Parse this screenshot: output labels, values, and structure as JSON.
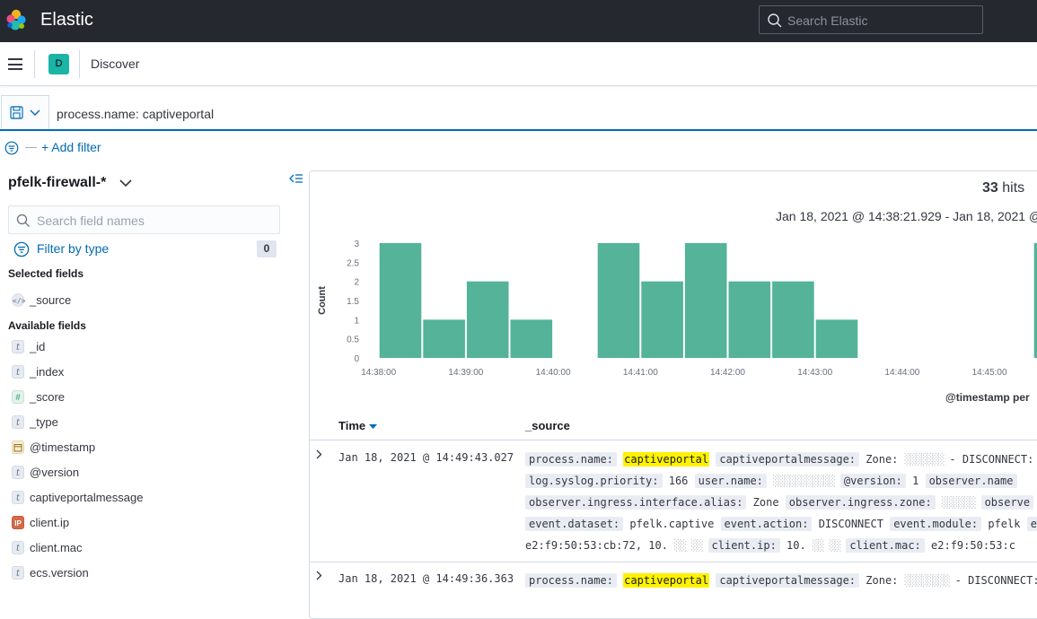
{
  "header": {
    "app_title": "Elastic",
    "search_placeholder": "Search Elastic"
  },
  "subheader": {
    "space_initial": "D",
    "breadcrumb": "Discover"
  },
  "query": {
    "text": "process.name: captiveportal"
  },
  "filters": {
    "add_filter_label": "+ Add filter",
    "dash": "—"
  },
  "sidebar": {
    "index_pattern": "pfelk-firewall-*",
    "field_search_placeholder": "Search field names",
    "filter_by_type_label": "Filter by type",
    "filter_count": "0",
    "selected_fields_title": "Selected fields",
    "available_fields_title": "Available fields",
    "selected_fields": [
      {
        "name": "_source",
        "type": "source"
      }
    ],
    "available_fields": [
      {
        "name": "_id",
        "type": "string"
      },
      {
        "name": "_index",
        "type": "string"
      },
      {
        "name": "_score",
        "type": "number"
      },
      {
        "name": "_type",
        "type": "string"
      },
      {
        "name": "@timestamp",
        "type": "date"
      },
      {
        "name": "@version",
        "type": "string"
      },
      {
        "name": "captiveportalmessage",
        "type": "string"
      },
      {
        "name": "client.ip",
        "type": "ip"
      },
      {
        "name": "client.mac",
        "type": "string"
      },
      {
        "name": "ecs.version",
        "type": "string"
      }
    ]
  },
  "results": {
    "hits_count": "33",
    "hits_label": "hits",
    "date_range": "Jan 18, 2021 @ 14:38:21.929 - Jan 18, 2021 @",
    "timestamp_per_label": "@timestamp per",
    "time_header": "Time",
    "source_header": "_source",
    "rows": [
      {
        "time": "Jan 18, 2021 @ 14:49:43.027",
        "lines": [
          [
            {
              "k": "process.name:",
              "v": "captiveportal",
              "hl": true
            },
            {
              "k": "captiveportalmessage:",
              "v": "Zone:"
            },
            {
              "blur": "░░░░░░░"
            },
            {
              "v": "- DISCONNECT:"
            }
          ],
          [
            {
              "k": "log.syslog.priority:",
              "v": "166"
            },
            {
              "k": "user.name:",
              "v": ""
            },
            {
              "blur": "░░░░░░░░░░░"
            },
            {
              "k": "@version:",
              "v": "1"
            },
            {
              "k": "observer.name",
              "v": ""
            }
          ],
          [
            {
              "k": "observer.ingress.interface.alias:",
              "v": "Zone"
            },
            {
              "k": "observer.ingress.zone:",
              "v": ""
            },
            {
              "blur": "░░░░░░"
            },
            {
              "k": "observe",
              "v": ""
            }
          ],
          [
            {
              "k": "event.dataset:",
              "v": "pfelk.captive"
            },
            {
              "k": "event.action:",
              "v": "DISCONNECT"
            },
            {
              "k": "event.module:",
              "v": "pfelk"
            },
            {
              "k": "eve",
              "v": ""
            }
          ],
          [
            {
              "v": "e2:f9:50:53:cb:72, 10."
            },
            {
              "blur": "░░ ░░"
            },
            {
              "k": "client.ip:",
              "v": "10."
            },
            {
              "blur": "░░ ░░"
            },
            {
              "k": "client.mac:",
              "v": "e2:f9:50:53:c"
            }
          ]
        ]
      },
      {
        "time": "Jan 18, 2021 @ 14:49:36.363",
        "lines": [
          [
            {
              "k": "process.name:",
              "v": "captiveportal",
              "hl": true
            },
            {
              "k": "captiveportalmessage:",
              "v": "Zone:"
            },
            {
              "blur": "░░░░░░░░"
            },
            {
              "v": "- DISCONNECT:"
            }
          ]
        ]
      }
    ]
  },
  "chart_data": {
    "type": "bar",
    "categories": [
      "14:38:00",
      "14:38:30",
      "14:39:00",
      "14:39:30",
      "14:40:00",
      "14:40:30",
      "14:41:00",
      "14:41:30",
      "14:42:00",
      "14:42:30",
      "14:43:00",
      "14:43:30",
      "14:44:00",
      "14:44:30",
      "14:45:00",
      "14:45:30"
    ],
    "values": [
      3,
      1,
      2,
      1,
      0,
      3,
      2,
      3,
      2,
      2,
      1,
      0,
      0,
      0,
      0,
      3
    ],
    "x_tick_labels": [
      "14:38:00",
      "14:39:00",
      "14:40:00",
      "14:41:00",
      "14:42:00",
      "14:43:00",
      "14:44:00",
      "14:45:00"
    ],
    "y_tick_labels": [
      "0",
      "0.5",
      "1",
      "1.5",
      "2",
      "2.5",
      "3"
    ],
    "ylabel": "Count",
    "xlabel": "@timestamp per",
    "ylim": [
      0,
      3
    ],
    "bar_color": "#54b399",
    "grid": false
  },
  "colors": {
    "header_bg": "#25282f",
    "accent": "#006bb4",
    "bar": "#54b399",
    "highlight": "#fff200",
    "space_badge": "#1bb5a7"
  }
}
